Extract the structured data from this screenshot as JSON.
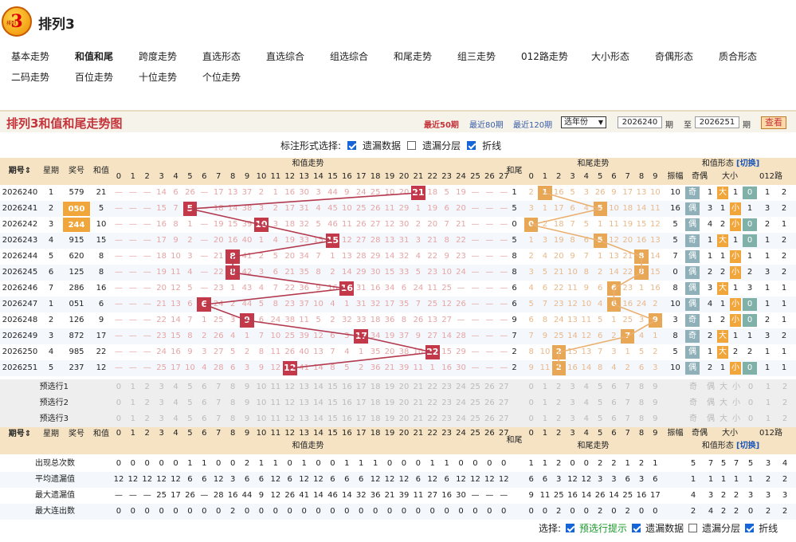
{
  "app": {
    "title": "排列3",
    "logo_text": "排列",
    "logo_digit": "3"
  },
  "nav": [
    "基本走势",
    "和值和尾",
    "跨度走势",
    "直选形态",
    "直选综合",
    "组选综合",
    "和尾走势",
    "组三走势",
    "012路走势",
    "大小形态",
    "奇偶形态",
    "质合形态",
    "二码走势",
    "百位走势",
    "十位走势",
    "个位走势"
  ],
  "nav_active": 1,
  "header": {
    "title": "排列3和值和尾走势图",
    "link50": "最近50期",
    "link80": "最近80期",
    "link120": "最近120期",
    "year_select": "选年份",
    "from": "2026240",
    "to": "2026251",
    "qi": "期",
    "zhi": "至",
    "query": "查看"
  },
  "options": {
    "label": "标注形式选择:",
    "miss": "遗漏数据",
    "layer": "遗漏分层",
    "line": "折线"
  },
  "cols": {
    "issue": "期号",
    "week": "星期",
    "award": "奖号",
    "sum": "和值",
    "sum_trend": "和值走势",
    "tail": "和尾",
    "tail_trend": "和尾走势",
    "form": "和值形态",
    "switch": "[切换]",
    "amp": "振幅",
    "oe": "奇偶",
    "bs": "大小",
    "r012": "012路",
    "odd": "奇",
    "even": "偶",
    "big": "大",
    "small": "小"
  },
  "rows": [
    {
      "issue": "2026240",
      "week": "1",
      "award": "579",
      "sum": 21,
      "tail": 1,
      "amp": 10,
      "miss": "— — — 14 6 26 — 17 13 37 2 1 16 30 3 44 9 24 25 10 20 21 18 5 19 — — —",
      "tmiss": "2 1 16 5 3 26 9 17 13 10"
    },
    {
      "issue": "2026241",
      "week": "2",
      "award": "050",
      "sum": 5,
      "tail": 5,
      "amp": 16,
      "miss": "— — — 15 7 5 — 18 14 38 3 2 17 31 4 45 10 25 26 11 29 1 19 6 20 — — —",
      "tmiss": "3 1 17 6 4 5 10 18 14 11"
    },
    {
      "issue": "2026242",
      "week": "3",
      "award": "244",
      "sum": 10,
      "tail": 0,
      "amp": 5,
      "miss": "— — — 16 8 1 — 19 15 39 10 3 18 32 5 46 11 26 27 12 30 2 20 7 21 — — —",
      "tmiss": "0 2 18 7 5 1 11 19 15 12"
    },
    {
      "issue": "2026243",
      "week": "4",
      "award": "915",
      "sum": 15,
      "tail": 5,
      "amp": 5,
      "miss": "— — — 17 9 2 — 20 16 40 1 4 19 33 15 47 12 27 28 13 31 3 21 8 22 — — —",
      "tmiss": "1 3 19 8 6 5 12 20 16 13"
    },
    {
      "issue": "2026244",
      "week": "5",
      "award": "620",
      "sum": 8,
      "tail": 8,
      "amp": 7,
      "miss": "— — — 18 10 3 — 21 8 41 2 5 20 34 7 1 13 28 29 14 32 4 22 9 23 — — —",
      "tmiss": "2 4 20 9 7 1 13 21 8 14"
    },
    {
      "issue": "2026245",
      "week": "6",
      "award": "125",
      "sum": 8,
      "tail": 8,
      "amp": 0,
      "miss": "— — — 19 11 4 — 22 8 42 3 6 21 35 8 2 14 29 30 15 33 5 23 10 24 — — —",
      "tmiss": "3 5 21 10 8 2 14 22 8 15"
    },
    {
      "issue": "2026246",
      "week": "7",
      "award": "286",
      "sum": 16,
      "tail": 6,
      "amp": 8,
      "miss": "— — — 20 12 5 — 23 1 43 4 7 22 36 9 16 30 31 16 34 6 24 11 25 — — — —",
      "tmiss": "4 6 22 11 9 6 15 23 1 16"
    },
    {
      "issue": "2026247",
      "week": "1",
      "award": "051",
      "sum": 6,
      "tail": 6,
      "amp": 10,
      "miss": "— — — 21 13 6 6 24 2 44 5 8 23 37 10 4 1 31 32 17 35 7 25 12 26 — — —",
      "tmiss": "5 7 23 12 10 4 6 16 24 2"
    },
    {
      "issue": "2026248",
      "week": "2",
      "award": "126",
      "sum": 9,
      "tail": 9,
      "amp": 3,
      "miss": "— — — 22 14 7 1 25 3 9 6 24 38 11 5 2 32 33 18 36 8 26 13 27 — — — —",
      "tmiss": "6 8 24 13 11 5 1 25 3 9"
    },
    {
      "issue": "2026249",
      "week": "3",
      "award": "872",
      "sum": 17,
      "tail": 7,
      "amp": 8,
      "miss": "— — — 23 15 8 2 26 4 1 7 10 25 39 12 6 3 17 34 19 37 9 27 14 28 — — —",
      "tmiss": "7 9 25 14 12 6 2 7 4 1"
    },
    {
      "issue": "2026250",
      "week": "4",
      "award": "985",
      "sum": 22,
      "tail": 2,
      "amp": 5,
      "miss": "— — — 24 16 9 3 27 5 2 8 11 26 40 13 7 4 1 35 20 38 10 22 15 29 — — —",
      "tmiss": "8 10 2 15 13 7 3 1 5 2"
    },
    {
      "issue": "2026251",
      "week": "5",
      "award": "237",
      "sum": 12,
      "tail": 2,
      "amp": 10,
      "miss": "— — — 25 17 10 4 28 6 3 9 12 27 41 14 8 5 2 36 21 39 11 1 16 30 — — —",
      "tmiss": "9 11 2 16 14 8 4 2 6 3"
    }
  ],
  "forms": [
    [
      "奇",
      "1",
      "大",
      "1",
      "0",
      "1",
      "2"
    ],
    [
      "偶",
      "3",
      "1",
      "小",
      "1",
      "3",
      "2"
    ],
    [
      "偶",
      "4",
      "2",
      "小",
      "0",
      "2",
      "1"
    ],
    [
      "奇",
      "1",
      "大",
      "1",
      "0",
      "1",
      "2"
    ],
    [
      "偶",
      "1",
      "1",
      "小",
      "1",
      "1",
      "2"
    ],
    [
      "偶",
      "2",
      "2",
      "小",
      "2",
      "3",
      "2"
    ],
    [
      "偶",
      "3",
      "大",
      "1",
      "3",
      "1",
      "1"
    ],
    [
      "偶",
      "4",
      "1",
      "小",
      "0",
      "1",
      "1"
    ],
    [
      "奇",
      "1",
      "2",
      "小",
      "0",
      "2",
      "1"
    ],
    [
      "奇",
      "2",
      "大",
      "1",
      "1",
      "3",
      "2"
    ],
    [
      "偶",
      "1",
      "大",
      "2",
      "2",
      "1",
      "1"
    ],
    [
      "偶",
      "2",
      "1",
      "小",
      "0",
      "1",
      "1"
    ]
  ],
  "pre": [
    "预选行1",
    "预选行2",
    "预选行3"
  ],
  "stats": {
    "labels": [
      "出现总次数",
      "平均遗漏值",
      "最大遗漏值",
      "最大连出数"
    ],
    "sum": [
      "0 0 0 0 0 1 1 0 0 2 1 1 0 1 0 0 1 1 1 0 0 0 1 1 0 0 0 0",
      "12 12 12 12 12 6 6 12 3 6 6 12 6 12 12 6 6 6 12 12 12 6 12 6 12 12 12 12",
      "— — — 25 17 26 — 28 16 44 9 12 26 41 14 46 14 32 36 21 39 11 27 16 30 — — —",
      "0 0 0 0 0 0 0 0 2 0 0 0 0 0 0 0 0 0 0 0 0 0 0 0 0 0 0 0"
    ],
    "tail": [
      "1 1 2 0 0 2 2 1 2 1",
      "6 6 3 12 12 3 3 6 3 6",
      "9 11 25 16 14 26 14 25 16 17",
      "0 0 2 0 0 2 0 2 0 0"
    ],
    "form": [
      "5 7 5 7 5 3 4",
      "1 1 1 1 1 2 2",
      "4 3 2 2 3 3 3",
      "2 4 2 2 0 2 2"
    ]
  },
  "footer": {
    "label": "选择:",
    "hint": "预选行提示",
    "miss": "遗漏数据",
    "layer": "遗漏分层",
    "line": "折线"
  },
  "colors": {
    "hit": "#c4394a",
    "tail_hit": "#e8a754",
    "odd_tag": "#8fb0b8",
    "big_tag": "#f0a63a",
    "r0": "#7fb1a8"
  }
}
